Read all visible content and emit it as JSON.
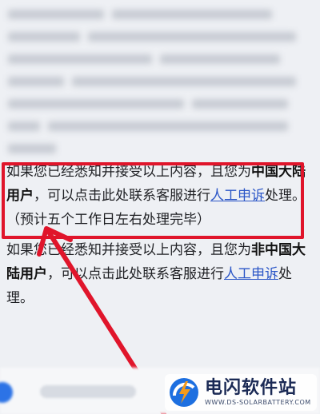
{
  "paragraphs": [
    {
      "pre": "如果您已经悉知并接受以上内容，且您为",
      "strong": "中国大陆用户",
      "mid": "，可以点击此处联系客服进行",
      "link": "人工申诉",
      "post": "处理。（预计五个工作日左右处理完毕）"
    },
    {
      "pre": "如果您已经悉知并接受以上内容，且您为",
      "strong": "非中国大陆用户",
      "mid": "，可以点击此处联系客服进行",
      "link": "人工申诉",
      "post": "处理。"
    }
  ],
  "watermark": {
    "title": "电闪软件站",
    "url": "WWW.DS-SOLARBATTERY.COM"
  },
  "colors": {
    "highlight": "#e0152b",
    "link": "#2b56c7",
    "accent": "#2c73e6"
  }
}
